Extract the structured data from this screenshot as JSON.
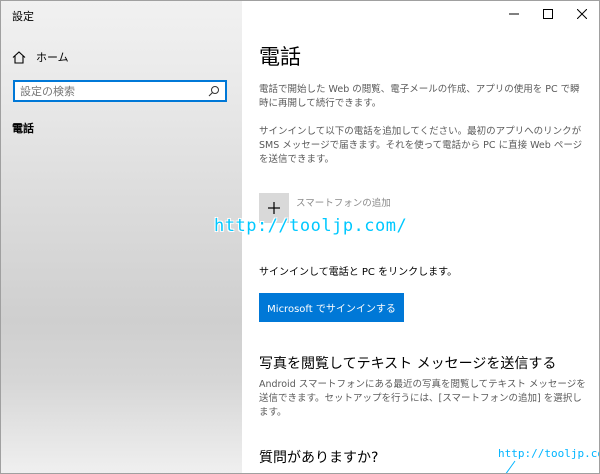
{
  "window": {
    "title": "設定",
    "controls": {
      "minimize": "—",
      "maximize": "☐",
      "close": "✕"
    }
  },
  "sidebar": {
    "home_label": "ホーム",
    "search": {
      "placeholder": "設定の検索",
      "value": ""
    },
    "category": "電話"
  },
  "main": {
    "title": "電話",
    "desc1": "電話で開始した Web の閲覧、電子メールの作成、アプリの使用を PC で瞬時に再開して続行できます。",
    "desc2": "サインインして以下の電話を追加してください。最初のアプリへのリンクが SMS メッセージで届きます。それを使って電話から PC に直接 Web ページを送信できます。",
    "add_phone_label": "スマートフォンの追加",
    "link_text": "サインインして電話と PC をリンクします。",
    "signin_button": "Microsoft でサインインする",
    "section1_title": "写真を閲覧してテキスト メッセージを送信する",
    "section1_desc": "Android スマートフォンにある最近の写真を閲覧してテキスト メッセージを送信できます。セットアップを行うには、[スマートフォンの追加] を選択します。",
    "section2_title": "質問がありますか?"
  },
  "watermarks": {
    "main": "http://tooljp.com/",
    "corner": "http://tooljp.com"
  },
  "colors": {
    "accent": "#0078d7",
    "watermark": "#00c8ff"
  }
}
